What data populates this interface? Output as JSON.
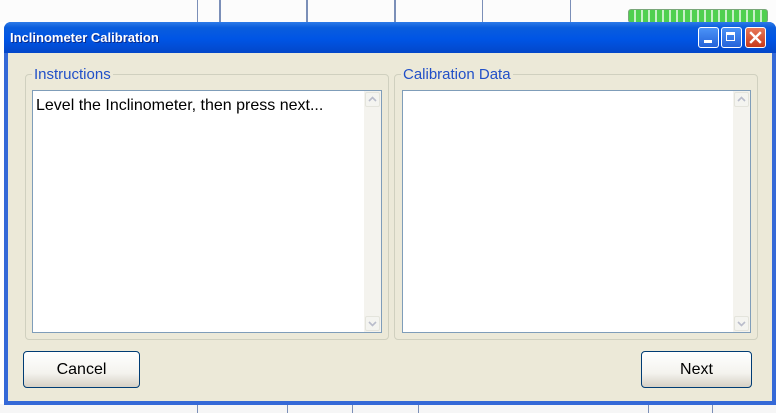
{
  "window": {
    "title": "Inclinometer Calibration",
    "controls": [
      "minimize-icon",
      "maximize-icon",
      "close-icon"
    ]
  },
  "instructions": {
    "label": "Instructions",
    "text": "Level the Inclinometer, then press next..."
  },
  "calibration": {
    "label": "Calibration Data",
    "text": ""
  },
  "buttons": {
    "cancel": "Cancel",
    "next": "Next"
  },
  "colors": {
    "title_bar": "#0055e5",
    "client_bg": "#ece9d8",
    "group_label": "#2150c8",
    "close_button": "#c8391a"
  }
}
